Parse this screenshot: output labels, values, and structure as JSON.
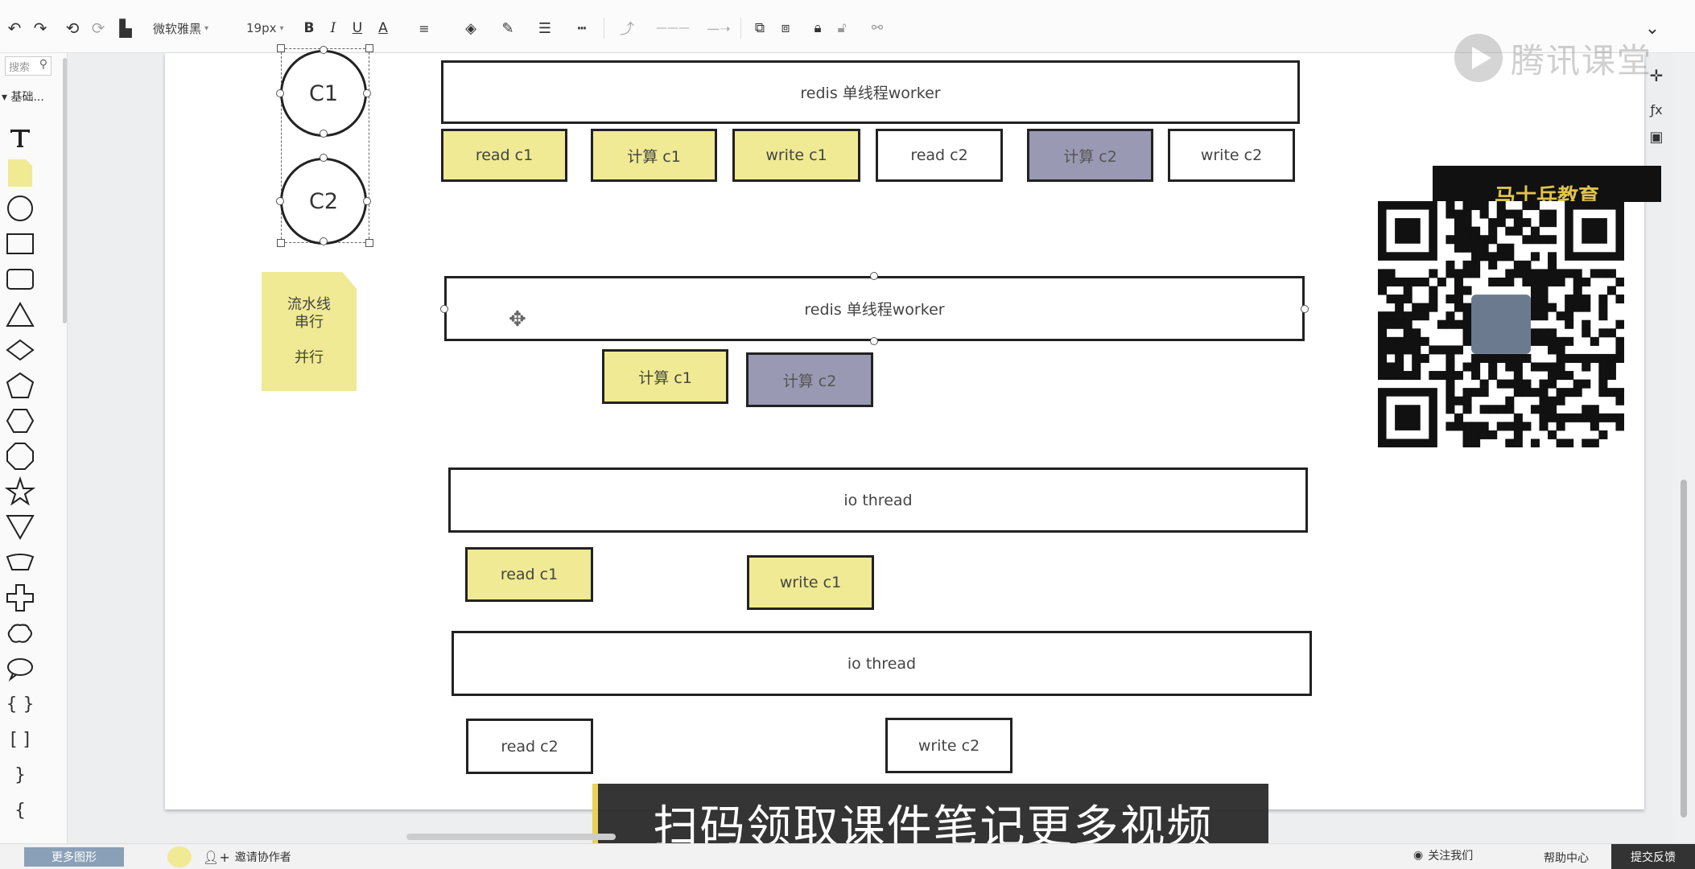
{
  "toolbar": {
    "font_family": "微软雅黑",
    "font_size": "19px",
    "bold": "B",
    "italic": "I",
    "underline": "U",
    "font_color": "A",
    "collapse": "⌄"
  },
  "left_panel": {
    "search_placeholder": "搜索",
    "section_title": "基础...",
    "more_shapes": "更多图形",
    "shapes": [
      "text",
      "note",
      "circle",
      "rectangle",
      "rounded-rectangle",
      "triangle",
      "diamond",
      "pentagon",
      "hexagon",
      "octagon",
      "star",
      "inverted-triangle",
      "trapezoid",
      "cross",
      "cloud",
      "ellipse",
      "braces",
      "brackets",
      "right-brace",
      "left-brace"
    ]
  },
  "diagram": {
    "circles": [
      "C1",
      "C2"
    ],
    "note": {
      "line1": "流水线",
      "line2": "串行",
      "line3": "并行"
    },
    "section1": {
      "title": "redis  单线程worker",
      "boxes": [
        "read c1",
        "计算 c1",
        "write c1",
        "read c2",
        "计算 c2",
        "write c2"
      ]
    },
    "section2": {
      "title": "redis  单线程worker",
      "boxes": [
        "计算 c1",
        "计算 c2"
      ]
    },
    "section3": {
      "title": "io thread",
      "boxes": [
        "read c1",
        "write c1"
      ]
    },
    "section4": {
      "title": "io  thread",
      "boxes": [
        "read c2",
        "write c2"
      ]
    }
  },
  "promo": {
    "banner": "马士兵教育",
    "watermark": "腾讯课堂"
  },
  "subtitle": "扫码领取课件笔记更多视频",
  "bottom_bar": {
    "invite": "邀请协作者",
    "follow": "关注我们",
    "help": "帮助中心",
    "feedback": "提交反馈"
  },
  "colors": {
    "yellow": "#efea93",
    "purple": "#9999b3",
    "subtitle_accent": "#e8d04f"
  }
}
